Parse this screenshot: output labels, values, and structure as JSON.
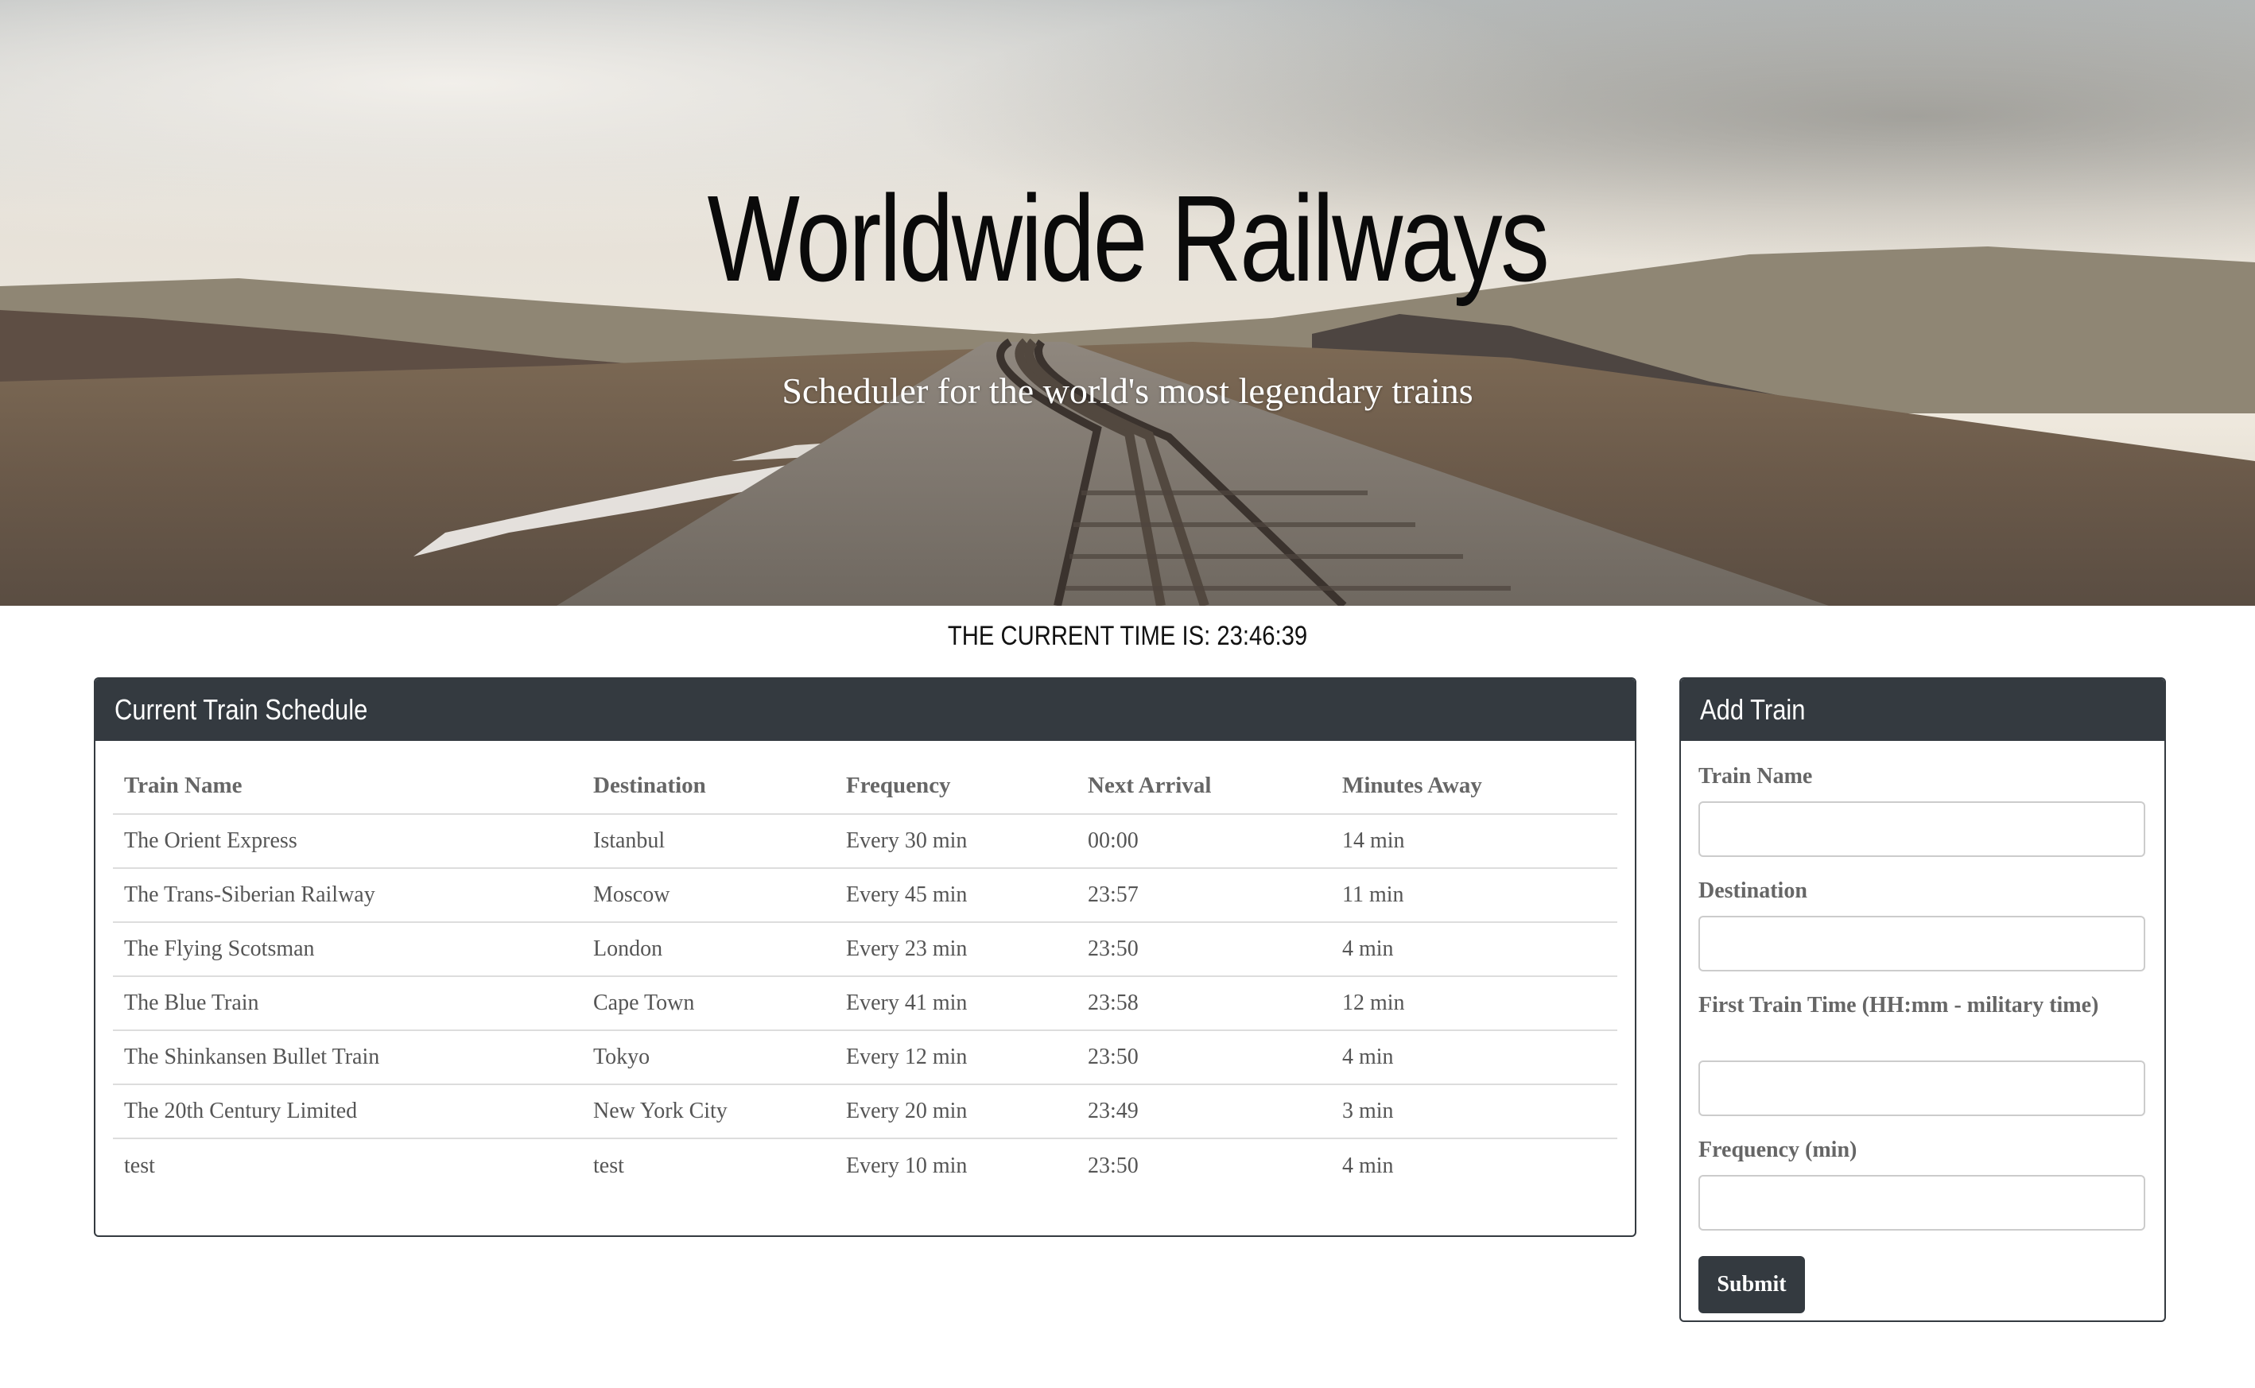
{
  "hero": {
    "title": "Worldwide Railways",
    "subtitle": "Scheduler for the world's most legendary trains"
  },
  "clock": {
    "text": "THE CURRENT TIME IS: 23:46:39"
  },
  "schedule": {
    "header": "Current Train Schedule",
    "columns": [
      "Train Name",
      "Destination",
      "Frequency",
      "Next Arrival",
      "Minutes Away"
    ],
    "rows": [
      [
        "The Orient Express",
        "Istanbul",
        "Every 30 min",
        "00:00",
        "14 min"
      ],
      [
        "The Trans-Siberian Railway",
        "Moscow",
        "Every 45 min",
        "23:57",
        "11 min"
      ],
      [
        "The Flying Scotsman",
        "London",
        "Every 23 min",
        "23:50",
        "4 min"
      ],
      [
        "The Blue Train",
        "Cape Town",
        "Every 41 min",
        "23:58",
        "12 min"
      ],
      [
        "The Shinkansen Bullet Train",
        "Tokyo",
        "Every 12 min",
        "23:50",
        "4 min"
      ],
      [
        "The 20th Century Limited",
        "New York City",
        "Every 20 min",
        "23:49",
        "3 min"
      ],
      [
        "test",
        "test",
        "Every 10 min",
        "23:50",
        "4 min"
      ]
    ]
  },
  "add_train": {
    "header": "Add Train",
    "fields": {
      "train_name": {
        "label": "Train Name",
        "value": ""
      },
      "destination": {
        "label": "Destination",
        "value": ""
      },
      "first_time": {
        "label": "First Train Time (HH:mm - military time)",
        "value": ""
      },
      "frequency": {
        "label": "Frequency (min)",
        "value": ""
      }
    },
    "submit_label": "Submit"
  },
  "colors": {
    "dark_header": "#343a40",
    "table_text": "#555555",
    "border": "#dddddd"
  }
}
